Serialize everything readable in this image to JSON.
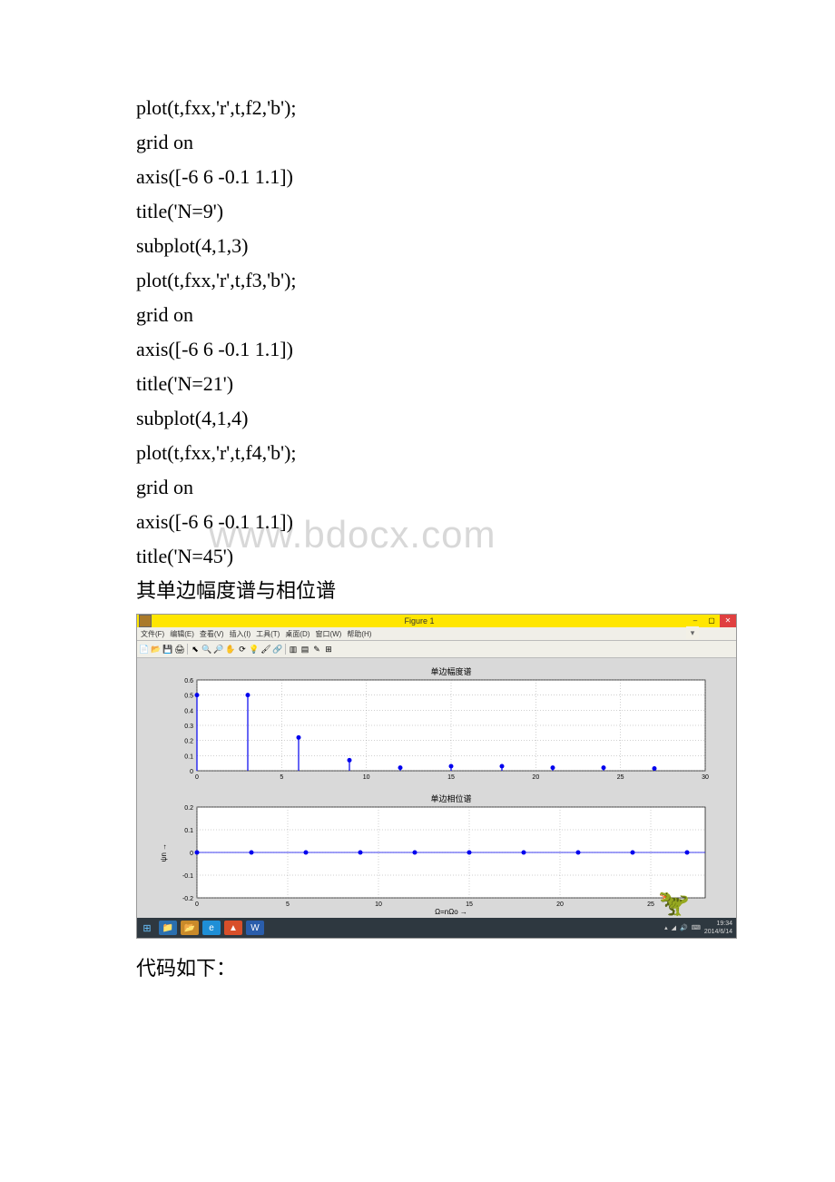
{
  "code_lines": [
    "plot(t,fxx,'r',t,f2,'b');",
    "grid on",
    "axis([-6 6 -0.1 1.1])",
    "title('N=9')",
    "subplot(4,1,3)",
    "plot(t,fxx,'r',t,f3,'b');",
    "grid on",
    "axis([-6 6 -0.1 1.1])",
    "title('N=21')",
    "subplot(4,1,4)",
    "plot(t,fxx,'r',t,f4,'b');",
    "grid on",
    "axis([-6 6 -0.1 1.1])",
    "title('N=45')"
  ],
  "watermark": "www.bdocx.com",
  "section_heading": "其单边幅度谱与相位谱",
  "footer_text": "代码如下：",
  "matlab": {
    "title": "Figure 1",
    "menu": [
      "文件(F)",
      "编辑(E)",
      "查看(V)",
      "插入(I)",
      "工具(T)",
      "桌面(D)",
      "窗口(W)",
      "帮助(H)"
    ],
    "toolbar_icons": [
      "new-icon",
      "open-icon",
      "save-icon",
      "print-icon",
      "pointer-icon",
      "zoomin-icon",
      "zoomout-icon",
      "pan-icon",
      "rotate-icon",
      "datatip-icon",
      "brush-icon",
      "link-icon",
      "colorbar-icon",
      "legend-icon",
      "annotate-icon",
      "subplot-icon"
    ]
  },
  "taskbar": {
    "clock_time": "19:34",
    "clock_date": "2014/6/14"
  },
  "chart_data": [
    {
      "type": "bar",
      "title": "单边幅度谱",
      "xlabel": "",
      "ylabel": "",
      "xlim": [
        0,
        30
      ],
      "ylim": [
        0,
        0.6
      ],
      "xticks": [
        0,
        5,
        10,
        15,
        20,
        25,
        30
      ],
      "yticks": [
        0,
        0.1,
        0.2,
        0.3,
        0.4,
        0.5,
        0.6
      ],
      "grid": true,
      "x": [
        0,
        3,
        6,
        9,
        12,
        15,
        18,
        21,
        24,
        27
      ],
      "values": [
        0.5,
        0.5,
        0.22,
        0.07,
        0.02,
        0.03,
        0.03,
        0.02,
        0.02,
        0.015
      ]
    },
    {
      "type": "bar",
      "title": "单边相位谱",
      "xlabel": "Ω=nΩo →",
      "ylabel": "ψn →",
      "xlim": [
        0,
        28
      ],
      "ylim": [
        -0.2,
        0.2
      ],
      "xticks": [
        0,
        5,
        10,
        15,
        20,
        25
      ],
      "yticks": [
        -0.2,
        -0.1,
        0,
        0.1,
        0.2
      ],
      "grid": true,
      "x": [
        0,
        3,
        6,
        9,
        12,
        15,
        18,
        21,
        24,
        27
      ],
      "values": [
        0,
        0,
        0,
        0,
        0,
        0,
        0,
        0,
        0,
        0
      ]
    }
  ]
}
